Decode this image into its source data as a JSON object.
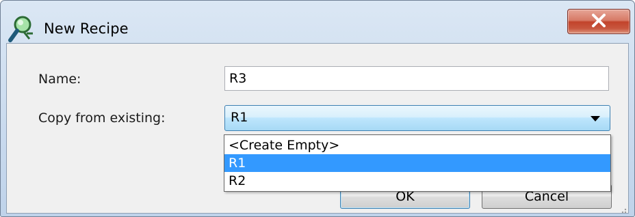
{
  "window": {
    "title": "New Recipe",
    "app_icon": "magnifier-icon",
    "close_icon": "close-icon",
    "close_color": "#c2432b"
  },
  "form": {
    "name_label": "Name:",
    "name_value": "R3",
    "copy_label": "Copy from existing:",
    "copy_selected": "R1"
  },
  "dropdown": {
    "options": [
      "<Create Empty>",
      "R1",
      "R2"
    ],
    "highlighted_index": 1,
    "highlight_color": "#3399ff"
  },
  "buttons": {
    "ok_label": "OK",
    "cancel_label": "Cancel"
  }
}
